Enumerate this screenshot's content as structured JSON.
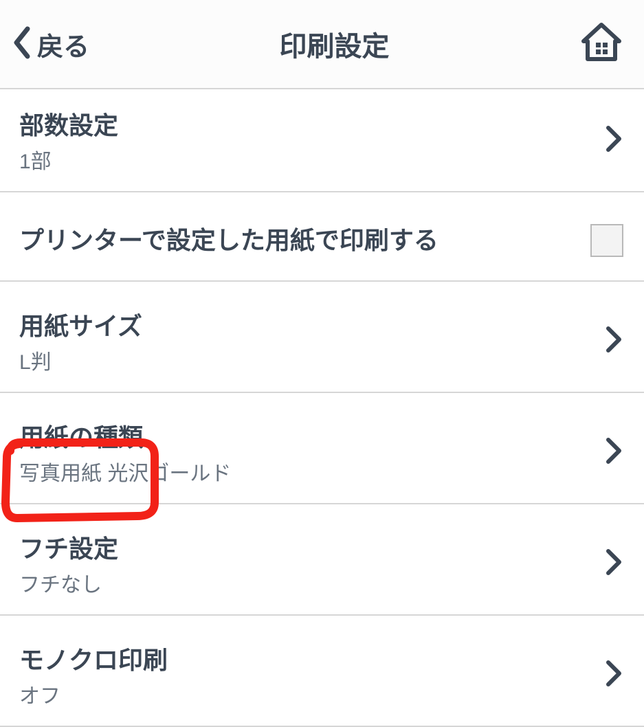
{
  "header": {
    "back_label": "戻る",
    "title": "印刷設定"
  },
  "rows": {
    "copies": {
      "title": "部数設定",
      "sub": "1部"
    },
    "printer_paper": {
      "title": "プリンターで設定した用紙で印刷する"
    },
    "paper_size": {
      "title": "用紙サイズ",
      "sub": "L判"
    },
    "paper_type": {
      "title": "用紙の種類",
      "sub": "写真用紙 光沢ゴールド"
    },
    "border": {
      "title": "フチ設定",
      "sub": "フチなし"
    },
    "mono": {
      "title": "モノクロ印刷",
      "sub": "オフ"
    }
  }
}
